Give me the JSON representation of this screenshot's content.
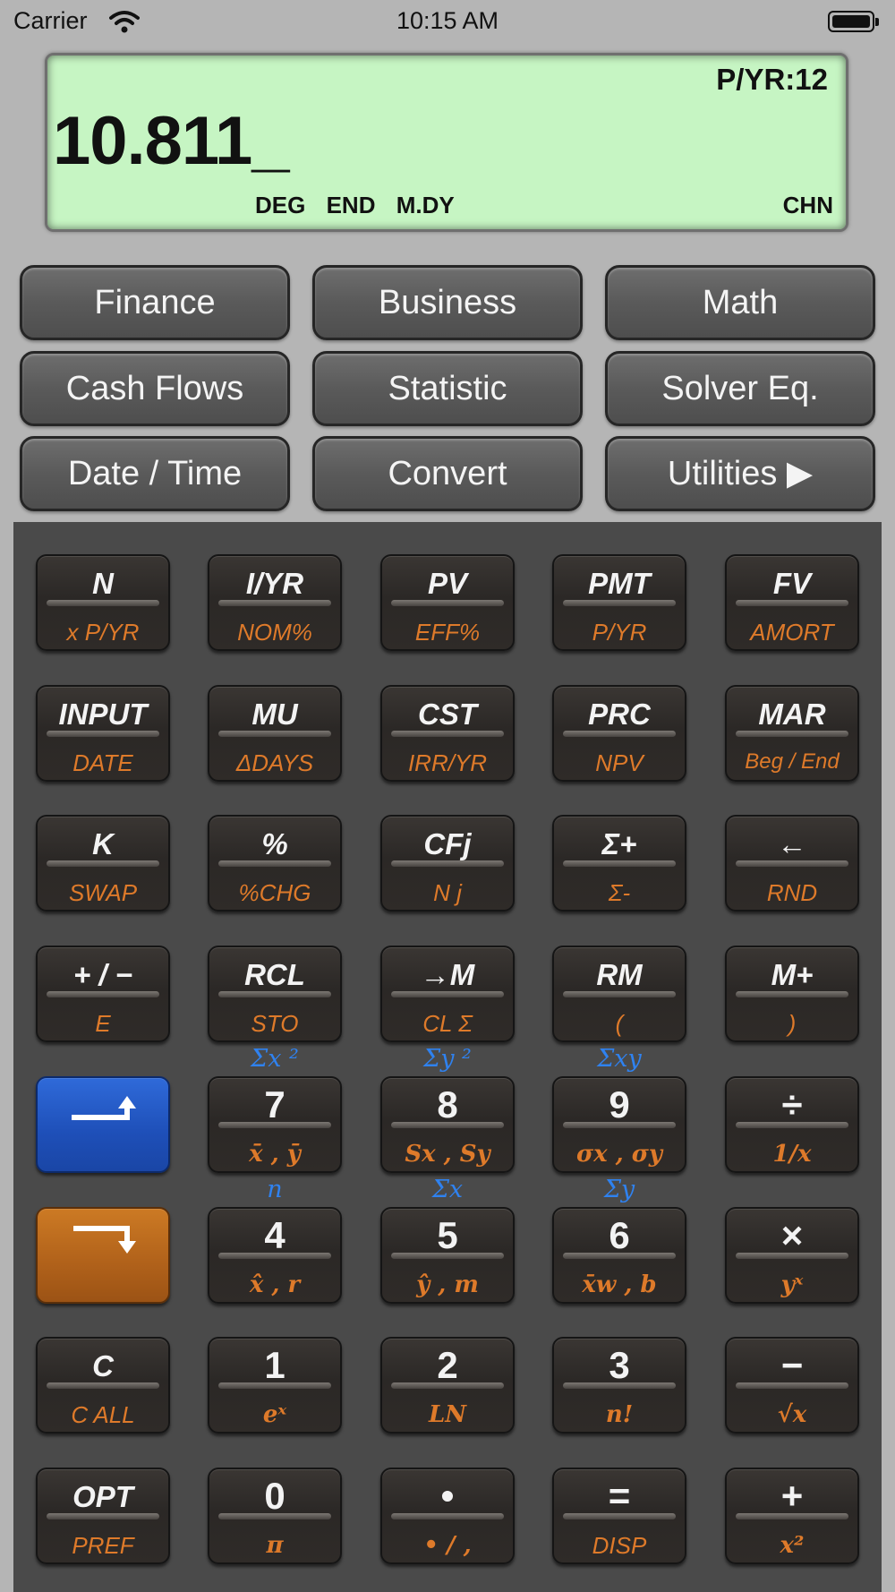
{
  "status": {
    "carrier": "Carrier",
    "time": "10:15 AM"
  },
  "display": {
    "pyr": "P/YR:12",
    "value": "10.811_",
    "annunciators": [
      "DEG",
      "END",
      "M.DY"
    ],
    "mode": "CHN"
  },
  "menu": [
    "Finance",
    "Business",
    "Math",
    "Cash Flows",
    "Statistic",
    "Solver Eq.",
    "Date / Time",
    "Convert",
    "Utilities ▶"
  ],
  "keys": [
    {
      "p": "N",
      "s": "x P/YR"
    },
    {
      "p": "I/YR",
      "s": "NOM%"
    },
    {
      "p": "PV",
      "s": "EFF%"
    },
    {
      "p": "PMT",
      "s": "P/YR"
    },
    {
      "p": "FV",
      "s": "AMORT"
    },
    {
      "p": "INPUT",
      "s": "DATE"
    },
    {
      "p": "MU",
      "s": "ΔDAYS"
    },
    {
      "p": "CST",
      "s": "IRR/YR"
    },
    {
      "p": "PRC",
      "s": "NPV"
    },
    {
      "p": "MAR",
      "s": "Beg / End"
    },
    {
      "p": "K",
      "s": "SWAP"
    },
    {
      "p": "%",
      "s": "%CHG"
    },
    {
      "p": "CFj",
      "s": "N j"
    },
    {
      "p": "Σ+",
      "s": "Σ-"
    },
    {
      "p": "←",
      "s": "RND"
    },
    {
      "p": "+ / −",
      "s": "E"
    },
    {
      "p": "RCL",
      "s": "STO"
    },
    {
      "p": "→M",
      "s": "CL Σ"
    },
    {
      "p": "RM",
      "s": "("
    },
    {
      "p": "M+",
      "s": ")"
    },
    {
      "p": "",
      "s": ""
    },
    {
      "p": "7",
      "s": "x̄ , ȳ"
    },
    {
      "p": "8",
      "s": "Sx , Sy"
    },
    {
      "p": "9",
      "s": "σx , σy"
    },
    {
      "p": "÷",
      "s": "1/x"
    },
    {
      "p": "",
      "s": ""
    },
    {
      "p": "4",
      "s": "x̂ , r"
    },
    {
      "p": "5",
      "s": "ŷ , m"
    },
    {
      "p": "6",
      "s": "x̄w , b"
    },
    {
      "p": "×",
      "s": "yˣ"
    },
    {
      "p": "C",
      "s": "C ALL"
    },
    {
      "p": "1",
      "s": "eˣ"
    },
    {
      "p": "2",
      "s": "LN"
    },
    {
      "p": "3",
      "s": "n!"
    },
    {
      "p": "−",
      "s": "√x"
    },
    {
      "p": "OPT",
      "s": "PREF"
    },
    {
      "p": "0",
      "s": "π"
    },
    {
      "p": "•",
      "s": "• / ,"
    },
    {
      "p": "=",
      "s": "DISP"
    },
    {
      "p": "+",
      "s": "x²"
    }
  ],
  "tertiary": [
    "Σx ²",
    "Σy ²",
    "Σxy",
    "n",
    "Σx",
    "Σy"
  ],
  "icons": {
    "up_shift": "up-shift-arrow-icon",
    "down_shift": "down-shift-arrow-icon"
  },
  "colors": {
    "lcd": "#c6f5c3",
    "shift_blue": "#2259c6",
    "shift_orange": "#b8661c",
    "secondary": "#de7a2a",
    "tertiary": "#2f82f0"
  }
}
